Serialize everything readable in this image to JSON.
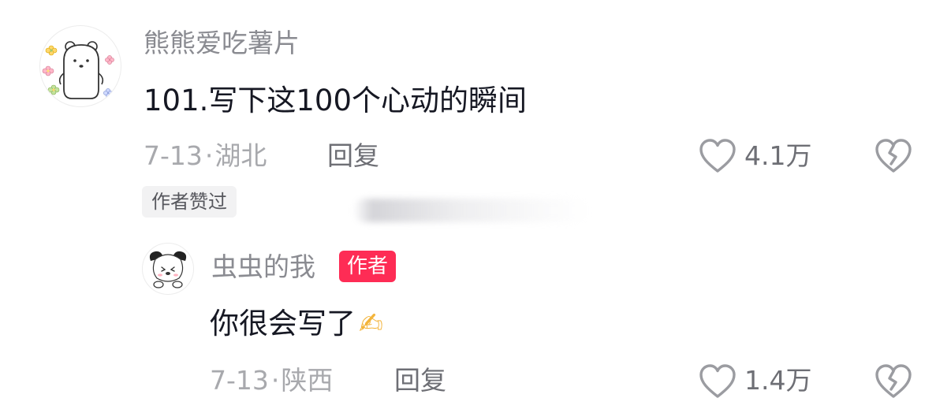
{
  "comment": {
    "username": "熊熊爱吃薯片",
    "content": "101.写下这100个心动的瞬间",
    "date": "7-13",
    "separator": "·",
    "location": "湖北",
    "reply_label": "回复",
    "like_count": "4.1万",
    "author_liked_badge": "作者赞过",
    "avatar_icon": "bear-avatar-icon"
  },
  "reply": {
    "username": "虫虫的我",
    "author_badge": "作者",
    "content": "你很会写了",
    "emoji": "✍",
    "date": "7-13",
    "separator": "·",
    "location": "陕西",
    "reply_label": "回复",
    "like_count": "1.4万",
    "avatar_icon": "pochacco-avatar-icon"
  },
  "colors": {
    "accent": "#fe2c55",
    "username": "#8a8b91",
    "content": "#161823",
    "meta": "#a8a9ad",
    "icon": "#9b9ca1"
  },
  "icons": [
    "heart-icon",
    "broken-heart-icon",
    "writing-hand-emoji"
  ]
}
